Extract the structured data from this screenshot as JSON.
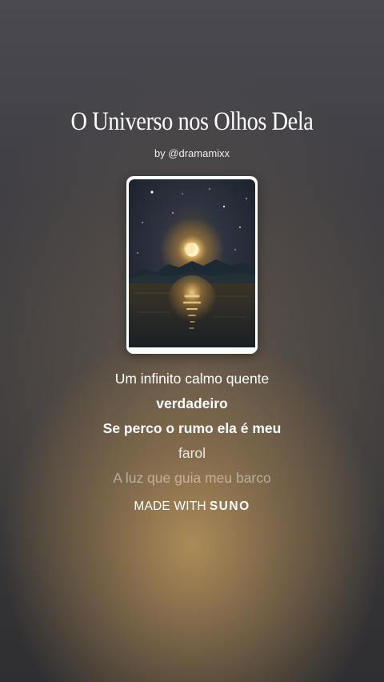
{
  "song": {
    "title": "O Universo nos Olhos Dela",
    "byline": "by @dramamixx"
  },
  "cover": {
    "icon": "moon-over-lake-artwork",
    "colors": {
      "sky": "#1f2a35",
      "glow": "#f3c46a",
      "water": "#20262c"
    }
  },
  "lyrics": {
    "lines": [
      "Um infinito calmo quente",
      "verdadeiro",
      "Se perco o rumo ela é meu",
      "farol",
      "A luz que guia meu barco"
    ]
  },
  "footer": {
    "made_with": "MADE WITH",
    "brand": "SUNO"
  }
}
